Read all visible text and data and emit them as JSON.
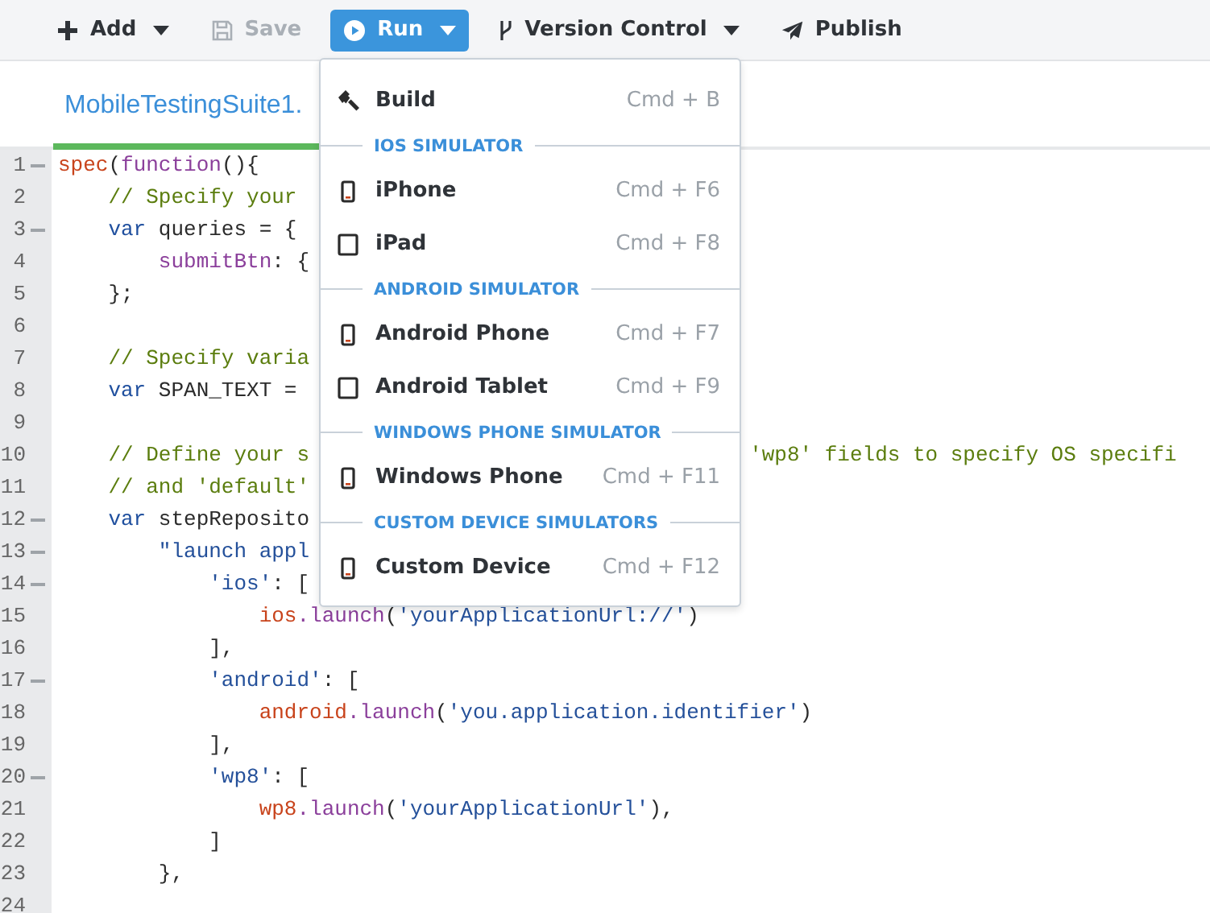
{
  "toolbar": [
    {
      "label": "Add",
      "has_menu": true,
      "disabled": false,
      "selected": false
    },
    {
      "label": "Save",
      "has_menu": false,
      "disabled": true,
      "selected": false
    },
    {
      "label": "Run",
      "has_menu": true,
      "disabled": false,
      "selected": true
    },
    {
      "label": "Version Control",
      "has_menu": true,
      "disabled": false,
      "selected": false
    },
    {
      "label": "Publish",
      "has_menu": false,
      "disabled": false,
      "selected": false
    }
  ],
  "tabs": [
    {
      "label": "MobileTestingSuite1.",
      "selected": true
    }
  ],
  "editor": {
    "lines": [
      {
        "number": "1",
        "foldable": true,
        "tokens": [
          {
            "kind": "fn",
            "text": "spec"
          },
          {
            "kind": "plain",
            "text": "("
          },
          {
            "kind": "prop",
            "text": "function"
          },
          {
            "kind": "plain",
            "text": "(){"
          }
        ]
      },
      {
        "number": "2",
        "foldable": false,
        "tokens": [
          {
            "kind": "comment",
            "text": "    // Specify your"
          }
        ]
      },
      {
        "number": "3",
        "foldable": true,
        "tokens": [
          {
            "kind": "kw",
            "text": "    var"
          },
          {
            "kind": "plain",
            "text": " queries = {"
          }
        ]
      },
      {
        "number": "4",
        "foldable": false,
        "tokens": [
          {
            "kind": "prop",
            "text": "        submitBtn"
          },
          {
            "kind": "plain",
            "text": ": {"
          }
        ]
      },
      {
        "number": "5",
        "foldable": false,
        "tokens": [
          {
            "kind": "plain",
            "text": "    };"
          }
        ]
      },
      {
        "number": "6",
        "foldable": false
      },
      {
        "number": "7",
        "foldable": false,
        "tokens": [
          {
            "kind": "comment",
            "text": "    // Specify varia"
          }
        ]
      },
      {
        "number": "8",
        "foldable": false,
        "tokens": [
          {
            "kind": "kw",
            "text": "    var"
          },
          {
            "kind": "plain",
            "text": " SPAN_TEXT ="
          }
        ]
      },
      {
        "number": "9",
        "foldable": false
      },
      {
        "number": "10",
        "foldable": false,
        "tokens": [
          {
            "kind": "comment",
            "text": "    // Define your s"
          }
        ],
        "tokens_right": [
          {
            "kind": "comment",
            "text": "'wp8' fields to specify OS specifi"
          }
        ]
      },
      {
        "number": "11",
        "foldable": false,
        "tokens": [
          {
            "kind": "comment",
            "text": "    // and 'default'"
          }
        ]
      },
      {
        "number": "12",
        "foldable": true,
        "tokens": [
          {
            "kind": "kw",
            "text": "    var"
          },
          {
            "kind": "plain",
            "text": " stepReposito"
          }
        ]
      },
      {
        "number": "13",
        "foldable": true,
        "tokens": [
          {
            "kind": "str",
            "text": "        \"launch appl"
          }
        ]
      },
      {
        "number": "14",
        "foldable": true,
        "tokens": [
          {
            "kind": "str",
            "text": "            'ios'"
          },
          {
            "kind": "plain",
            "text": ": ["
          }
        ]
      },
      {
        "number": "15",
        "foldable": false,
        "tokens": [
          {
            "kind": "fn",
            "text": "                ios"
          },
          {
            "kind": "prop",
            "text": ".launch"
          },
          {
            "kind": "plain",
            "text": "("
          },
          {
            "kind": "str",
            "text": "'yourApplicationUrl://'"
          },
          {
            "kind": "plain",
            "text": ")"
          }
        ]
      },
      {
        "number": "16",
        "foldable": false,
        "tokens": [
          {
            "kind": "plain",
            "text": "            ],"
          }
        ]
      },
      {
        "number": "17",
        "foldable": true,
        "tokens": [
          {
            "kind": "str",
            "text": "            'android'"
          },
          {
            "kind": "plain",
            "text": ": ["
          }
        ]
      },
      {
        "number": "18",
        "foldable": false,
        "tokens": [
          {
            "kind": "fn",
            "text": "                android"
          },
          {
            "kind": "prop",
            "text": ".launch"
          },
          {
            "kind": "plain",
            "text": "("
          },
          {
            "kind": "str",
            "text": "'you.application.identifier'"
          },
          {
            "kind": "plain",
            "text": ")"
          }
        ]
      },
      {
        "number": "19",
        "foldable": false,
        "tokens": [
          {
            "kind": "plain",
            "text": "            ],"
          }
        ]
      },
      {
        "number": "20",
        "foldable": true,
        "tokens": [
          {
            "kind": "str",
            "text": "            'wp8'"
          },
          {
            "kind": "plain",
            "text": ": ["
          }
        ]
      },
      {
        "number": "21",
        "foldable": false,
        "tokens": [
          {
            "kind": "fn",
            "text": "                wp8"
          },
          {
            "kind": "prop",
            "text": ".launch"
          },
          {
            "kind": "plain",
            "text": "("
          },
          {
            "kind": "str",
            "text": "'yourApplicationUrl'"
          },
          {
            "kind": "plain",
            "text": "),"
          }
        ]
      },
      {
        "number": "22",
        "foldable": false,
        "tokens": [
          {
            "kind": "plain",
            "text": "            ]"
          }
        ]
      },
      {
        "number": "23",
        "foldable": false,
        "tokens": [
          {
            "kind": "plain",
            "text": "        },"
          }
        ]
      },
      {
        "number": "24",
        "foldable": false
      }
    ]
  },
  "run_menu": [
    {
      "kind": "action",
      "label": "Build",
      "shortcut": "Cmd + B"
    },
    {
      "kind": "section",
      "label": "IOS SIMULATOR"
    },
    {
      "kind": "phone",
      "label": "iPhone",
      "shortcut": "Cmd + F6"
    },
    {
      "kind": "tablet",
      "label": "iPad",
      "shortcut": "Cmd + F8"
    },
    {
      "kind": "section",
      "label": "ANDROID SIMULATOR"
    },
    {
      "kind": "phone",
      "label": "Android Phone",
      "shortcut": "Cmd + F7"
    },
    {
      "kind": "tablet",
      "label": "Android Tablet",
      "shortcut": "Cmd + F9"
    },
    {
      "kind": "section",
      "label": "WINDOWS PHONE SIMULATOR"
    },
    {
      "kind": "phone",
      "label": "Windows Phone",
      "shortcut": "Cmd + F11"
    },
    {
      "kind": "section",
      "label": "CUSTOM DEVICE SIMULATORS"
    },
    {
      "kind": "phone",
      "label": "Custom Device",
      "shortcut": "Cmd + F12"
    }
  ]
}
